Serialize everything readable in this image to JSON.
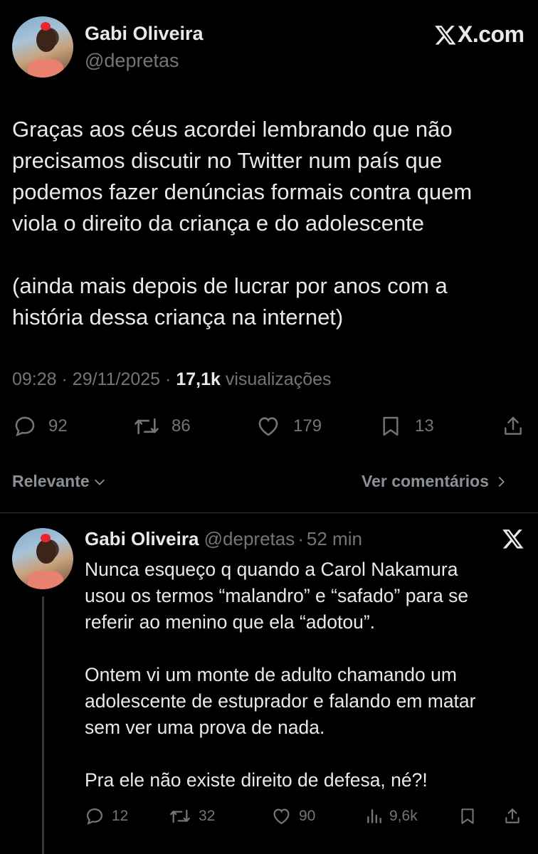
{
  "main_tweet": {
    "author_name": "Gabi Oliveira",
    "author_handle": "@depretas",
    "site_label": "X.com",
    "text_lines": [
      "Graças aos céus acordei lembrando que não",
      "precisamos discutir no Twitter num país que",
      "podemos fazer denúncias formais contra quem",
      "viola o direito da criança e do adolescente",
      "",
      "(ainda mais depois de lucrar por anos com a",
      "história dessa criança na internet)"
    ],
    "time": "09:28",
    "date": "29/11/2025",
    "views_count": "17,1k",
    "views_label": "visualizações",
    "separator": "·",
    "stats": {
      "replies": "92",
      "reposts": "86",
      "likes": "179",
      "bookmarks": "13"
    }
  },
  "sort": {
    "label": "Relevante",
    "view_comments_label": "Ver comentários"
  },
  "reply": {
    "author_name": "Gabi Oliveira",
    "author_handle": "@depretas",
    "separator": "·",
    "time_ago": "52 min",
    "text_lines": [
      "Nunca esqueço q quando a Carol Nakamura",
      "usou os termos “malandro” e “safado” para se",
      "referir ao menino que ela “adotou”.",
      "",
      "Ontem vi um monte de adulto chamando um",
      "adolescente de estuprador e falando em matar",
      "sem ver uma prova de nada.",
      "",
      "Pra ele não existe direito de defesa, né?!"
    ],
    "stats": {
      "replies": "12",
      "reposts": "32",
      "likes": "90",
      "views": "9,6k"
    }
  },
  "colors": {
    "background": "#000000",
    "text": "#e7e9ea",
    "muted": "#71767b",
    "divider": "#2f3336"
  },
  "icons": [
    "x-logo-icon",
    "reply-icon",
    "repost-icon",
    "like-icon",
    "bookmark-icon",
    "share-icon",
    "chevron-down-icon",
    "chevron-right-icon",
    "views-icon"
  ]
}
